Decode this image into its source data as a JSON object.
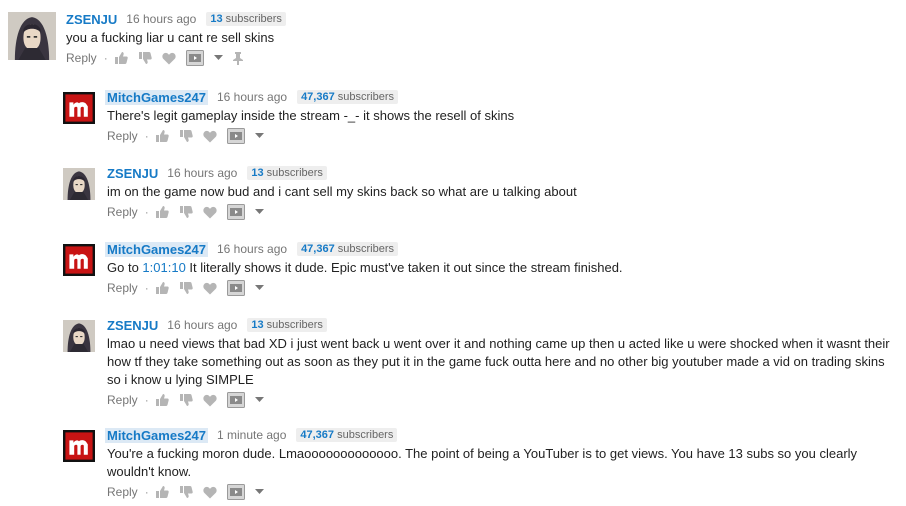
{
  "ui": {
    "reply_label": "Reply",
    "bullet": "·"
  },
  "comments": [
    {
      "author": "ZSENJU",
      "time": "16 hours ago",
      "subs_count": "13",
      "subs_label": "subscribers",
      "text": "you a fucking liar u cant re sell skins"
    },
    {
      "author": "MitchGames247",
      "time": "16 hours ago",
      "subs_count": "47,367",
      "subs_label": "subscribers",
      "text": "There's legit gameplay inside the stream -_- it shows the resell of skins"
    },
    {
      "author": "ZSENJU",
      "time": "16 hours ago",
      "subs_count": "13",
      "subs_label": "subscribers",
      "text": "im on the game now bud and i cant sell my skins back so what are u talking about"
    },
    {
      "author": "MitchGames247",
      "time": "16 hours ago",
      "subs_count": "47,367",
      "subs_label": "subscribers",
      "text_before": "Go to ",
      "timestamp_link": "1:01:10",
      "text_after": " It literally shows it dude. Epic must've taken it out since the stream finished."
    },
    {
      "author": "ZSENJU",
      "time": "16 hours ago",
      "subs_count": "13",
      "subs_label": "subscribers",
      "text": "lmao u need views that bad XD i just went back u went over it and nothing came up then u acted like u were shocked when it wasnt their how tf they take something out as soon as they put it in the game fuck outta here and no other big youtuber made a vid on trading skins so i know u lying SIMPLE"
    },
    {
      "author": "MitchGames247",
      "time": "1 minute ago",
      "subs_count": "47,367",
      "subs_label": "subscribers",
      "text": "You're a fucking moron dude. Lmaooooooooooooo. The point of being a YouTuber is to get views. You have 13 subs so you clearly wouldn't know."
    }
  ]
}
